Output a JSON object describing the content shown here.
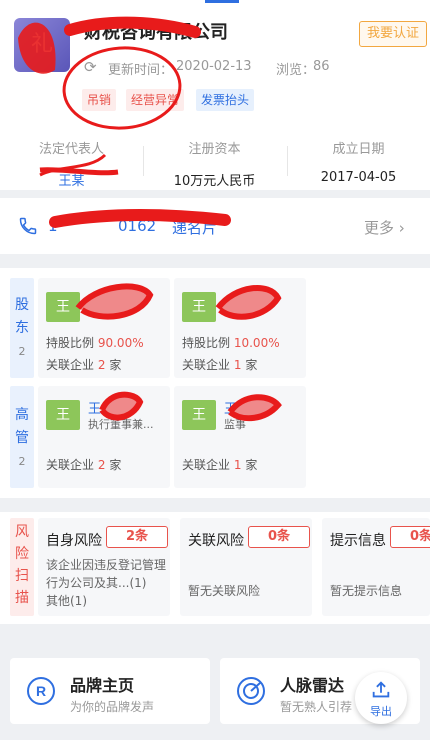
{
  "header": {
    "logo_text": "礼",
    "company_name": "财税咨询有限公司",
    "verify_label": "我要认证",
    "update_label": "更新时间：",
    "update_value": "2020-02-13",
    "views_label": "浏览：",
    "views_value": "86",
    "tags": [
      "吊销",
      "经营异常",
      "发票抬头"
    ]
  },
  "info": [
    {
      "label": "法定代表人",
      "value": "王某"
    },
    {
      "label": "注册资本",
      "value": "10万元人民币"
    },
    {
      "label": "成立日期",
      "value": "2017-04-05"
    }
  ],
  "contact": {
    "phone": "1",
    "phone_tail": "0162",
    "vcard_label": "递名片",
    "more_label": "更多"
  },
  "shareholders": {
    "label_chars": [
      "股",
      "东"
    ],
    "count": "2",
    "items": [
      {
        "avatar": "王",
        "ratio_label": "持股比例",
        "ratio": "90.00%",
        "related_label": "关联企业",
        "related_count": "2",
        "unit": "家"
      },
      {
        "avatar": "王",
        "ratio_label": "持股比例",
        "ratio": "10.00%",
        "related_label": "关联企业",
        "related_count": "1",
        "unit": "家"
      }
    ]
  },
  "executives": {
    "label_chars": [
      "高",
      "管"
    ],
    "count": "2",
    "items": [
      {
        "avatar": "王",
        "name": "王",
        "role": "执行董事兼...",
        "related_label": "关联企业",
        "related_count": "2",
        "unit": "家"
      },
      {
        "avatar": "王",
        "name": "王",
        "role": "监事",
        "related_label": "关联企业",
        "related_count": "1",
        "unit": "家"
      }
    ]
  },
  "risk": {
    "label_chars": [
      "风",
      "险",
      "扫",
      "描"
    ],
    "items": [
      {
        "title": "自身风险",
        "count": "2条",
        "desc": "该企业因违反登记管理行为公司及其...(1)",
        "desc2": "其他(1)"
      },
      {
        "title": "关联风险",
        "count": "0条",
        "desc": "暂无关联风险",
        "desc2": ""
      },
      {
        "title": "提示信息",
        "count": "0条",
        "desc": "暂无提示信息",
        "desc2": ""
      }
    ]
  },
  "bottom": [
    {
      "title": "品牌主页",
      "sub": "为你的品牌发声"
    },
    {
      "title": "人脉雷达",
      "sub": "暂无熟人引荐"
    }
  ],
  "export_label": "导出",
  "colors": {
    "accent": "#2f6fe0",
    "risk": "#e8534c",
    "warning": "#f2a740",
    "avatar": "#8dc65a"
  }
}
